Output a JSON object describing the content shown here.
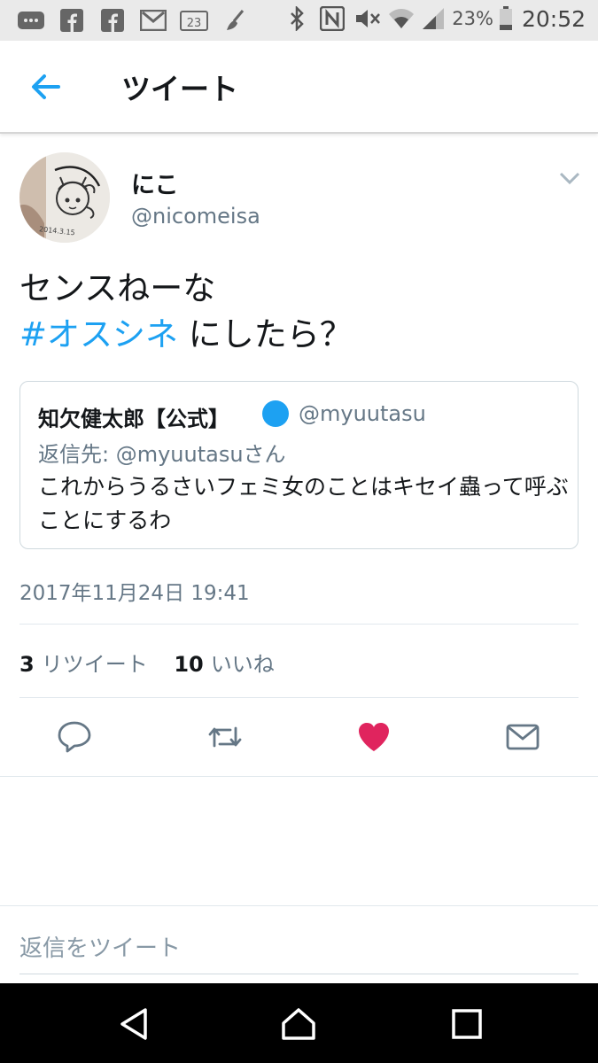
{
  "status_bar": {
    "badge": "23",
    "battery": "23%",
    "time": "20:52"
  },
  "header": {
    "title": "ツイート"
  },
  "tweet": {
    "name": "にこ",
    "handle": "@nicomeisa",
    "avatar_caption": "2014.3.15",
    "line1": "センスねーな",
    "hashtag": "#オスシネ",
    "line2_rest": " にしたら？",
    "timestamp": "2017年11月24日 19:41",
    "retweets": "3",
    "retweets_label": "リツイート",
    "likes": "10",
    "likes_label": "いいね"
  },
  "quoted": {
    "name": "知欠健太郎【公式】",
    "handle": "@myuutasu",
    "reply_to": "返信先: @myuutasuさん",
    "text": "これからうるさいフェミ女のことはキセイ蟲って呼ぶことにするわ"
  },
  "reply_box": {
    "placeholder": "返信をツイート"
  },
  "colors": {
    "accent": "#1da1f2",
    "like": "#e0245e",
    "secondary_text": "#657786"
  }
}
